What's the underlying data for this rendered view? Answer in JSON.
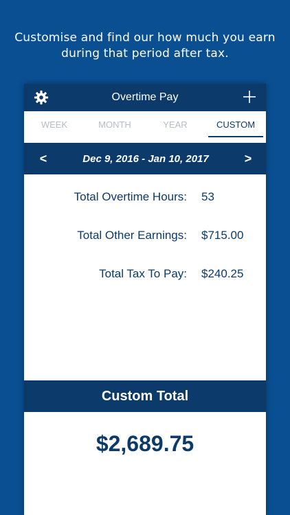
{
  "caption": {
    "line1": "Customise and find our how much you earn",
    "line2": "during that period after tax."
  },
  "navbar": {
    "title": "Overtime Pay",
    "left_icon": "gear-icon",
    "right_icon": "plus-icon"
  },
  "tabs": [
    {
      "label": "WEEK",
      "active": false
    },
    {
      "label": "MONTH",
      "active": false
    },
    {
      "label": "YEAR",
      "active": false
    },
    {
      "label": "CUSTOM",
      "active": true
    }
  ],
  "date_range": {
    "prev": "<",
    "label": "Dec 9, 2016 - Jan 10, 2017",
    "next": ">"
  },
  "stats": [
    {
      "label": "Total Overtime Hours:",
      "value": "53"
    },
    {
      "label": "Total Other Earnings:",
      "value": "$715.00"
    },
    {
      "label": "Total Tax To Pay:",
      "value": "$240.25"
    }
  ],
  "total": {
    "header": "Custom Total",
    "value": "$2,689.75"
  },
  "colors": {
    "background": "#0a4f92",
    "primary": "#0b3a6b",
    "inactive_tab": "#b5bcc4"
  }
}
